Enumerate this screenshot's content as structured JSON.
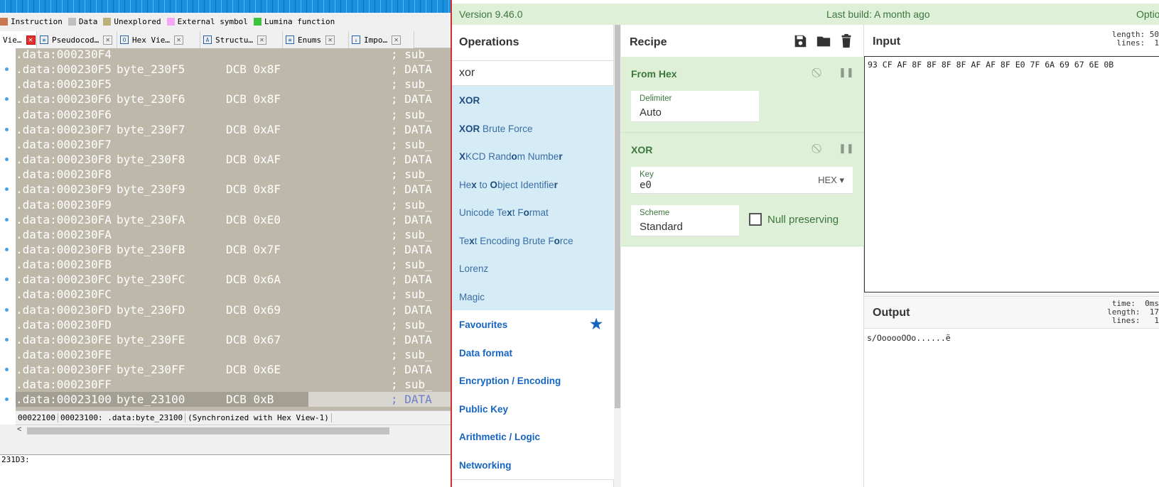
{
  "ida": {
    "legend": [
      {
        "label": "Instruction",
        "color": "#c87850"
      },
      {
        "label": "Data",
        "color": "#c0c0c0"
      },
      {
        "label": "Unexplored",
        "color": "#b9b07a"
      },
      {
        "label": "External symbol",
        "color": "#f4a8f4"
      },
      {
        "label": "Lumina function",
        "color": "#3cc43c"
      }
    ],
    "tabs": [
      {
        "label": "Vie…",
        "close": "✕"
      },
      {
        "label": "Pseudocod…",
        "close": "✕"
      },
      {
        "label": "Hex Vie…",
        "close": "✕"
      },
      {
        "label": "Structu…",
        "close": "✕"
      },
      {
        "label": "Enums",
        "close": "✕"
      },
      {
        "label": "Impo…",
        "close": "✕"
      }
    ],
    "lines": [
      {
        "addr": ".data:000230F4",
        "label": "",
        "mnem": "",
        "comment": "; sub_"
      },
      {
        "addr": ".data:000230F5",
        "label": "byte_230F5",
        "mnem": "DCB 0x8F",
        "comment": "; DATA"
      },
      {
        "addr": ".data:000230F5",
        "label": "",
        "mnem": "",
        "comment": "; sub_"
      },
      {
        "addr": ".data:000230F6",
        "label": "byte_230F6",
        "mnem": "DCB 0x8F",
        "comment": "; DATA"
      },
      {
        "addr": ".data:000230F6",
        "label": "",
        "mnem": "",
        "comment": "; sub_"
      },
      {
        "addr": ".data:000230F7",
        "label": "byte_230F7",
        "mnem": "DCB 0xAF",
        "comment": "; DATA"
      },
      {
        "addr": ".data:000230F7",
        "label": "",
        "mnem": "",
        "comment": "; sub_"
      },
      {
        "addr": ".data:000230F8",
        "label": "byte_230F8",
        "mnem": "DCB 0xAF",
        "comment": "; DATA"
      },
      {
        "addr": ".data:000230F8",
        "label": "",
        "mnem": "",
        "comment": "; sub_"
      },
      {
        "addr": ".data:000230F9",
        "label": "byte_230F9",
        "mnem": "DCB 0x8F",
        "comment": "; DATA"
      },
      {
        "addr": ".data:000230F9",
        "label": "",
        "mnem": "",
        "comment": "; sub_"
      },
      {
        "addr": ".data:000230FA",
        "label": "byte_230FA",
        "mnem": "DCB 0xE0",
        "comment": "; DATA"
      },
      {
        "addr": ".data:000230FA",
        "label": "",
        "mnem": "",
        "comment": "; sub_"
      },
      {
        "addr": ".data:000230FB",
        "label": "byte_230FB",
        "mnem": "DCB 0x7F",
        "comment": "; DATA"
      },
      {
        "addr": ".data:000230FB",
        "label": "",
        "mnem": "",
        "comment": "; sub_"
      },
      {
        "addr": ".data:000230FC",
        "label": "byte_230FC",
        "mnem": "DCB 0x6A",
        "comment": "; DATA"
      },
      {
        "addr": ".data:000230FC",
        "label": "",
        "mnem": "",
        "comment": "; sub_"
      },
      {
        "addr": ".data:000230FD",
        "label": "byte_230FD",
        "mnem": "DCB 0x69",
        "comment": "; DATA"
      },
      {
        "addr": ".data:000230FD",
        "label": "",
        "mnem": "",
        "comment": "; sub_"
      },
      {
        "addr": ".data:000230FE",
        "label": "byte_230FE",
        "mnem": "DCB 0x67",
        "comment": "; DATA"
      },
      {
        "addr": ".data:000230FE",
        "label": "",
        "mnem": "",
        "comment": "; sub_"
      },
      {
        "addr": ".data:000230FF",
        "label": "byte_230FF",
        "mnem": "DCB 0x6E",
        "comment": "; DATA"
      },
      {
        "addr": ".data:000230FF",
        "label": "",
        "mnem": "",
        "comment": "; sub_"
      },
      {
        "addr": ".data:00023100",
        "label": "byte_23100",
        "mnem": "DCB 0xB",
        "comment": "; DATA",
        "selected": true
      }
    ],
    "status": [
      "00022100",
      "00023100: .data:byte_23100",
      "(Synchronized with Hex View-1)"
    ],
    "scroll_left": "<",
    "bottom_lines": [
      "231D3:"
    ]
  },
  "cc": {
    "version": "Version 9.46.0",
    "last_build": "Last build: A month ago",
    "options": "Optio",
    "operations": {
      "title": "Operations",
      "search": "xor",
      "results": [
        {
          "html_parts": [
            {
              "t": "XOR",
              "b": true
            }
          ]
        },
        {
          "html_parts": [
            {
              "t": "XOR",
              "b": true
            },
            {
              "t": " Brute Force",
              "b": false
            }
          ]
        },
        {
          "html_parts": [
            {
              "t": "X",
              "b": true
            },
            {
              "t": "KCD Rand",
              "b": false
            },
            {
              "t": "o",
              "b": true
            },
            {
              "t": "m Numbe",
              "b": false
            },
            {
              "t": "r",
              "b": true
            }
          ]
        },
        {
          "html_parts": [
            {
              "t": "He",
              "b": false
            },
            {
              "t": "x",
              "b": true
            },
            {
              "t": " to ",
              "b": false
            },
            {
              "t": "O",
              "b": true
            },
            {
              "t": "bject Identifie",
              "b": false
            },
            {
              "t": "r",
              "b": true
            }
          ]
        },
        {
          "html_parts": [
            {
              "t": "Unicode Te",
              "b": false
            },
            {
              "t": "x",
              "b": true
            },
            {
              "t": "t F",
              "b": false
            },
            {
              "t": "o",
              "b": true
            },
            {
              "t": "rmat",
              "b": false
            }
          ]
        },
        {
          "html_parts": [
            {
              "t": "Te",
              "b": false
            },
            {
              "t": "x",
              "b": true
            },
            {
              "t": "t Encoding Brute F",
              "b": false
            },
            {
              "t": "o",
              "b": true
            },
            {
              "t": "rce",
              "b": false
            }
          ]
        },
        {
          "html_parts": [
            {
              "t": "Lorenz",
              "b": false
            }
          ]
        },
        {
          "html_parts": [
            {
              "t": "Magic",
              "b": false
            }
          ]
        }
      ],
      "categories": [
        "Favourites",
        "Data format",
        "Encryption / Encoding",
        "Public Key",
        "Arithmetic / Logic",
        "Networking"
      ]
    },
    "recipe": {
      "title": "Recipe",
      "ops": [
        {
          "name": "From Hex",
          "fields": [
            {
              "label": "Delimiter",
              "value": "Auto"
            }
          ]
        },
        {
          "name": "XOR",
          "key_label": "Key",
          "key_value": "e0",
          "key_format": "HEX",
          "scheme_label": "Scheme",
          "scheme_value": "Standard",
          "null_label": "Null preserving"
        }
      ]
    },
    "input": {
      "title": "Input",
      "stats": "length: 50\n lines:  1",
      "value": "93 CF AF 8F 8F 8F 8F AF AF 8F E0 7F 6A 69 67 6E 0B"
    },
    "output": {
      "title": "Output",
      "stats": "  time:  0ms\nlength:  17\n lines:   1",
      "value": "s/OooooOOo......ë"
    },
    "colors": {
      "banner_bg": "#dff0d8",
      "recipe_bg": "#dff0d8",
      "op_highlight": "#d5ebf5",
      "accent": "#1565c0"
    }
  }
}
